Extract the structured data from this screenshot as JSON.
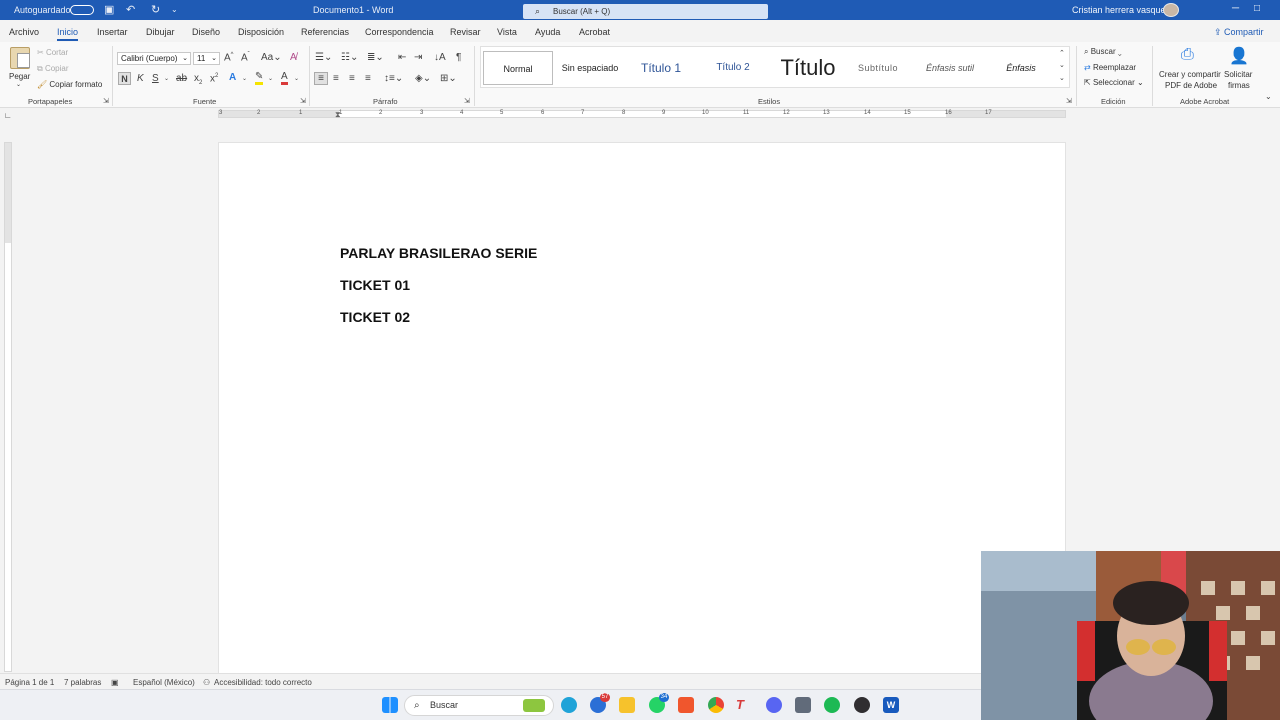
{
  "titlebar": {
    "autosave": "Autoguardado",
    "document": "Documento1 - Word",
    "search_placeholder": "Buscar (Alt + Q)",
    "user": "Cristian herrera vasquez"
  },
  "tabs": [
    "Archivo",
    "Inicio",
    "Insertar",
    "Dibujar",
    "Diseño",
    "Disposición",
    "Referencias",
    "Correspondencia",
    "Revisar",
    "Vista",
    "Ayuda",
    "Acrobat"
  ],
  "share_label": "Compartir",
  "clipboard": {
    "paste": "Pegar",
    "cut": "Cortar",
    "copy": "Copiar",
    "format_painter": "Copiar formato",
    "label": "Portapapeles"
  },
  "font": {
    "family": "Calibri (Cuerpo)",
    "size": "11",
    "label": "Fuente",
    "bold": "N",
    "italic": "K",
    "underline": "S"
  },
  "paragraph": {
    "label": "Párrafo"
  },
  "styles": {
    "label": "Estilos",
    "items": [
      "Normal",
      "Sin espaciado",
      "Título 1",
      "Título 2",
      "Título",
      "Subtítulo",
      "Énfasis sutil",
      "Énfasis"
    ]
  },
  "editing": {
    "label": "Edición",
    "find": "Buscar",
    "replace": "Reemplazar",
    "select": "Seleccionar"
  },
  "acrobat": {
    "label": "Adobe Acrobat",
    "create_line1": "Crear y compartir",
    "create_line2": "PDF de Adobe",
    "sign_line1": "Solicitar",
    "sign_line2": "firmas"
  },
  "ruler": [
    "3",
    "2",
    "1",
    "1",
    "2",
    "3",
    "4",
    "5",
    "6",
    "7",
    "8",
    "9",
    "10",
    "11",
    "12",
    "13",
    "14",
    "15",
    "16",
    "17"
  ],
  "document": {
    "lines": [
      "PARLAY BRASILERAO SERIE",
      "TICKET 01",
      "TICKET 02"
    ]
  },
  "status": {
    "page": "Página 1 de 1",
    "words": "7 palabras",
    "language": "Español (México)",
    "accessibility": "Accesibilidad: todo correcto"
  },
  "taskbar": {
    "search": "Buscar",
    "badge_browser": "57",
    "badge_whatsapp": "34"
  },
  "colors": {
    "accent": "#1f5bb5",
    "font_color": "#d93a3a",
    "highlight": "#f5e400"
  }
}
